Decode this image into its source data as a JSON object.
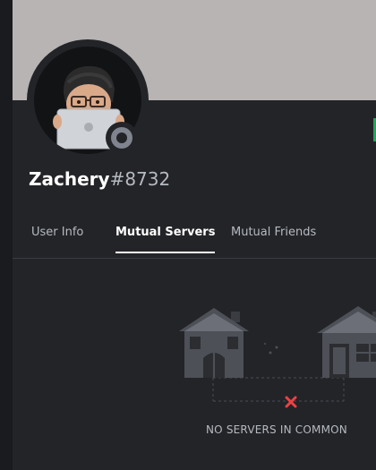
{
  "profile": {
    "username": "Zachery",
    "discriminator": "#8732"
  },
  "tabs": [
    {
      "label": "User Info",
      "active": false
    },
    {
      "label": "Mutual Servers",
      "active": true
    },
    {
      "label": "Mutual Friends",
      "active": false
    }
  ],
  "empty_state": {
    "message": "NO SERVERS IN COMMON"
  },
  "colors": {
    "banner": "#b8b4b4",
    "panel": "#232428",
    "status_offline": "#80848e",
    "error_x": "#ed4245"
  }
}
